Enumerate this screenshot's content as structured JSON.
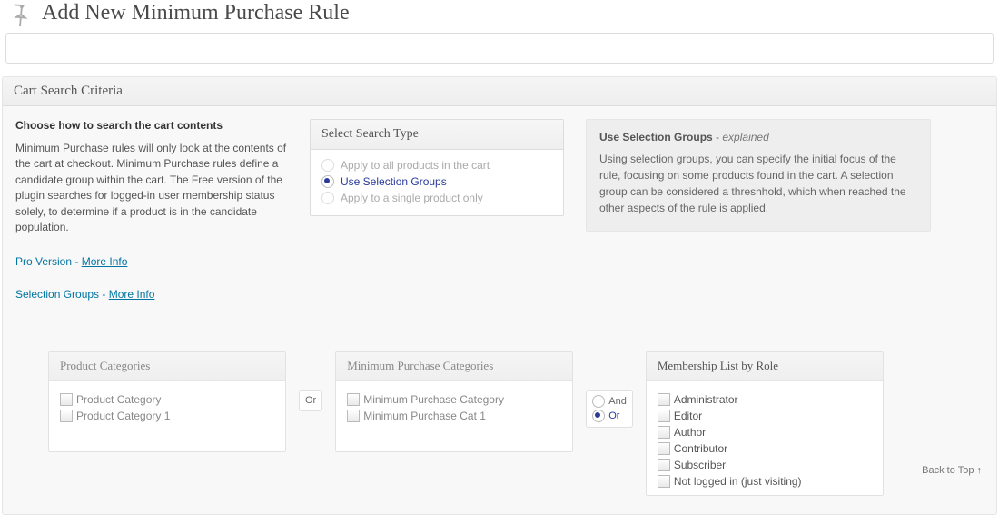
{
  "header": {
    "title": "Add New Minimum Purchase Rule",
    "title_input_value": "",
    "title_input_placeholder": ""
  },
  "panel": {
    "title": "Cart Search Criteria",
    "left": {
      "lead": "Choose how to search the cart contents",
      "body": "Minimum Purchase rules will only look at the contents of the cart at checkout. Minimum Purchase rules define a candidate group within the cart. The Free version of the plugin searches for logged-in user membership status solely, to determine if a product is in the candidate population.",
      "pro_prefix": "Pro Version - ",
      "pro_link": "More Info",
      "sel_prefix": "Selection Groups - ",
      "sel_link": "More Info"
    },
    "search_type": {
      "header": "Select Search Type",
      "options": [
        {
          "label": "Apply to all products in the cart",
          "state": "disabled"
        },
        {
          "label": "Use Selection Groups",
          "state": "selected"
        },
        {
          "label": "Apply to a single product only",
          "state": "disabled"
        }
      ]
    },
    "explain": {
      "title_bold": "Use Selection Groups",
      "title_dash": " - ",
      "title_ital": "explained",
      "body": "Using selection groups, you can specify the initial focus of the rule, focusing on some products found in the cart. A selection group can be considered a threshhold, which when reached the other aspects of the rule is applied."
    },
    "boxes": {
      "product_categories": {
        "header": "Product Categories",
        "items": [
          "Product Category",
          "Product Category 1"
        ]
      },
      "min_purchase": {
        "header": "Minimum Purchase Categories",
        "items": [
          "Minimum Purchase Category",
          "Minimum Purchase Cat 1"
        ]
      },
      "membership": {
        "header": "Membership List by Role",
        "items": [
          "Administrator",
          "Editor",
          "Author",
          "Contributor",
          "Subscriber",
          "Not logged in (just visiting)"
        ]
      }
    },
    "connector1": {
      "options": [
        "Or"
      ],
      "selected": null
    },
    "connector2": {
      "options": [
        "And",
        "Or"
      ],
      "selected": "Or"
    },
    "back_top": "Back to Top ↑"
  }
}
